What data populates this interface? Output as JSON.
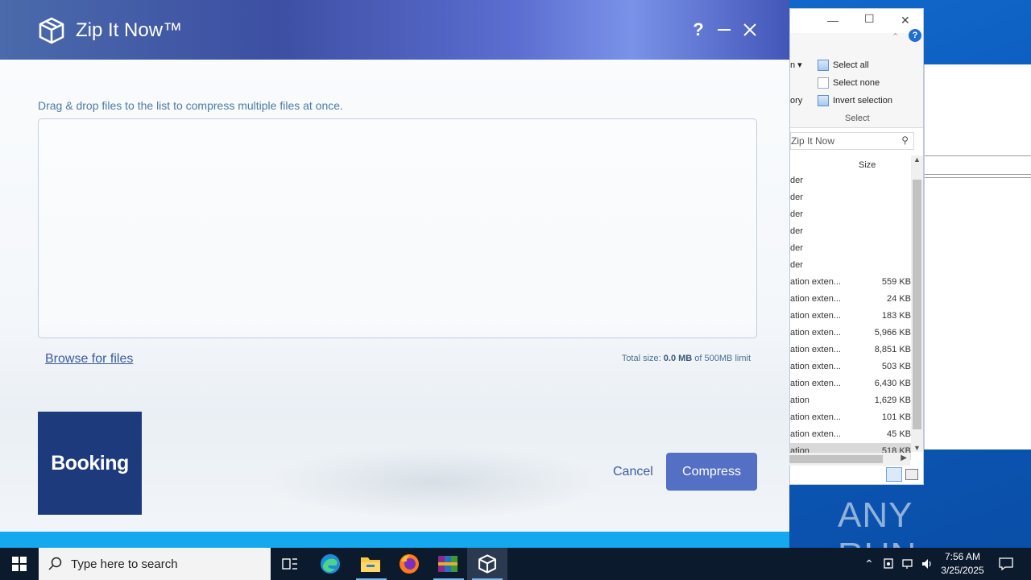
{
  "app": {
    "title": "Zip It Now™",
    "help_label": "?",
    "hint": "Drag & drop files to the list to compress multiple files at once.",
    "browse_label": "Browse for files",
    "total_prefix": "Total size: ",
    "total_value": "0.0 MB",
    "total_suffix": " of 500MB limit",
    "ad_label": "Booking",
    "cancel_label": "Cancel",
    "compress_label": "Compress"
  },
  "explorer": {
    "ribbon": {
      "cut_menu": "n",
      "history": "ory",
      "select_all": "Select all",
      "select_none": "Select none",
      "invert_selection": "Invert selection",
      "group_label": "Select"
    },
    "address": "Zip It Now",
    "size_header": "Size",
    "rows": [
      {
        "type": "der",
        "size": ""
      },
      {
        "type": "der",
        "size": ""
      },
      {
        "type": "der",
        "size": ""
      },
      {
        "type": "der",
        "size": ""
      },
      {
        "type": "der",
        "size": ""
      },
      {
        "type": "der",
        "size": ""
      },
      {
        "type": "ation exten...",
        "size": "559 KB"
      },
      {
        "type": "ation exten...",
        "size": "24 KB"
      },
      {
        "type": "ation exten...",
        "size": "183 KB"
      },
      {
        "type": "ation exten...",
        "size": "5,966 KB"
      },
      {
        "type": "ation exten...",
        "size": "8,851 KB"
      },
      {
        "type": "ation exten...",
        "size": "503 KB"
      },
      {
        "type": "ation exten...",
        "size": "6,430 KB"
      },
      {
        "type": "ation",
        "size": "1,629 KB"
      },
      {
        "type": "ation exten...",
        "size": "101 KB"
      },
      {
        "type": "ation exten...",
        "size": "45 KB"
      },
      {
        "type": "ation",
        "size": "518 KB"
      }
    ]
  },
  "watermark": "ANY RUN",
  "taskbar": {
    "search_placeholder": "Type here to search",
    "time": "7:56 AM",
    "date": "3/25/2025"
  }
}
